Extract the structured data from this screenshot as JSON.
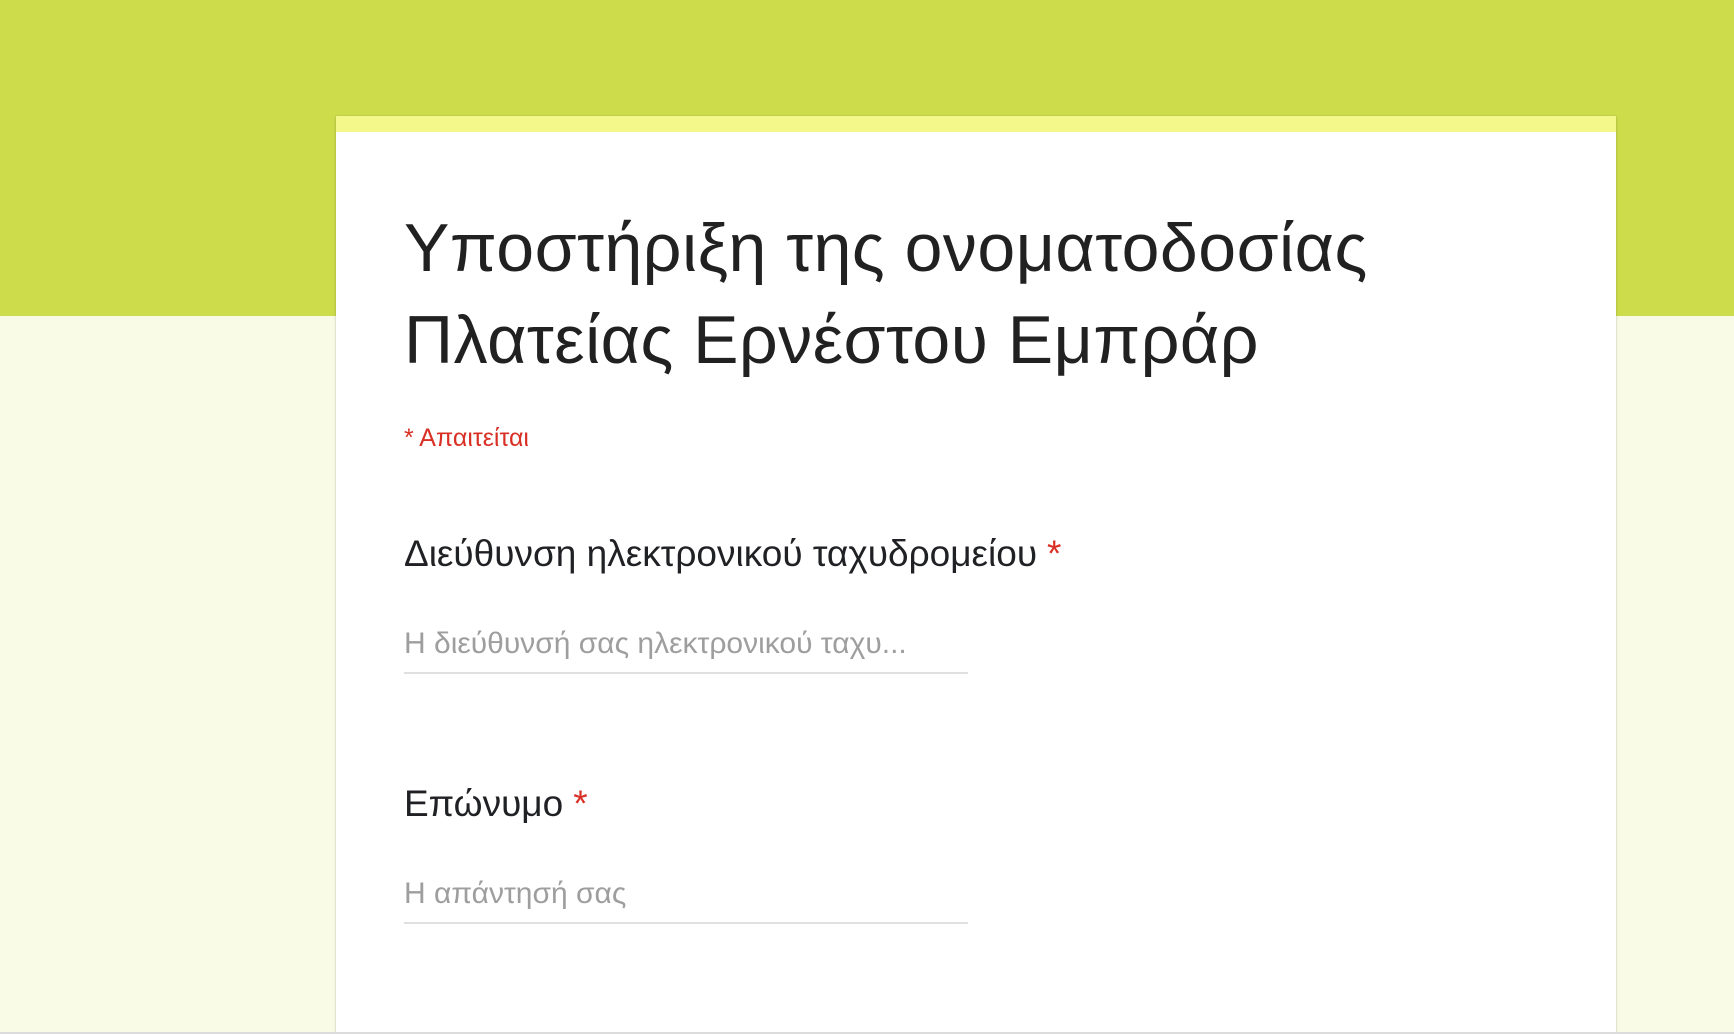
{
  "theme": {
    "header_color": "#cddc4b",
    "background_color": "#f9fbe7",
    "card_accent_color": "#f4f88a",
    "required_color": "#d93025"
  },
  "form": {
    "title_line1": "Υποστήριξη της ονοματοδοσίας",
    "title_line2": "Πλατείας Ερνέστου Εμπράρ",
    "required_note": "* Απαιτείται",
    "questions": [
      {
        "label": "Διεύθυνση ηλεκτρονικού ταχυδρομείου",
        "required_mark": "*",
        "value": "",
        "placeholder": "Η διεύθυνσή σας ηλεκτρονικού ταχυ..."
      },
      {
        "label": "Επώνυμο",
        "required_mark": "*",
        "value": "",
        "placeholder": "Η απάντησή σας"
      }
    ]
  }
}
